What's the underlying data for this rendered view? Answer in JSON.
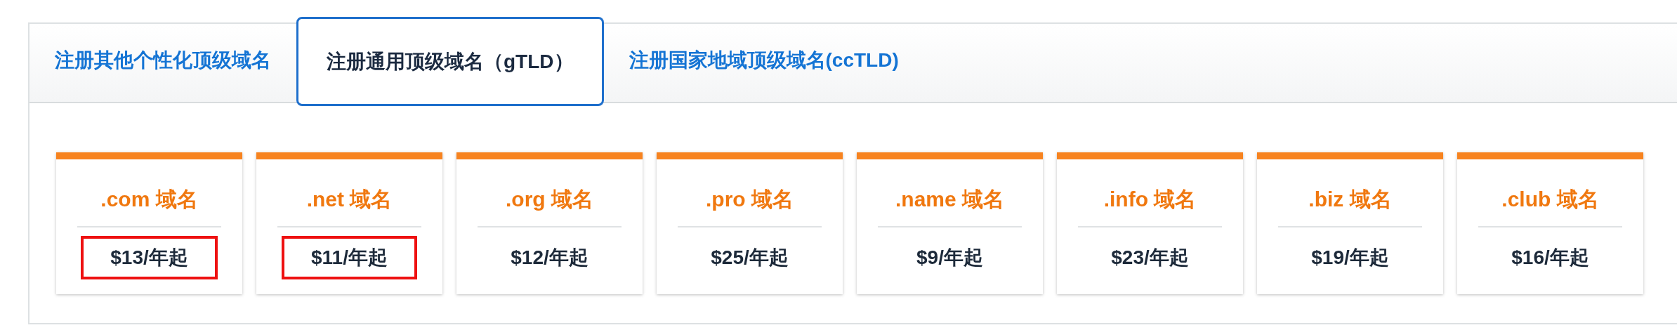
{
  "tabs": [
    {
      "label": "注册其他个性化顶级域名",
      "selected": false
    },
    {
      "label": "注册通用顶级域名（gTLD）",
      "selected": true
    },
    {
      "label": "注册国家地域顶级域名(ccTLD)",
      "selected": false
    }
  ],
  "domains": [
    {
      "name": ".com 域名",
      "price": "$13/年起",
      "highlighted": true
    },
    {
      "name": ".net 域名",
      "price": "$11/年起",
      "highlighted": true
    },
    {
      "name": ".org 域名",
      "price": "$12/年起",
      "highlighted": false
    },
    {
      "name": ".pro 域名",
      "price": "$25/年起",
      "highlighted": false
    },
    {
      "name": ".name 域名",
      "price": "$9/年起",
      "highlighted": false
    },
    {
      "name": ".info 域名",
      "price": "$23/年起",
      "highlighted": false
    },
    {
      "name": ".biz 域名",
      "price": "$19/年起",
      "highlighted": false
    },
    {
      "name": ".club 域名",
      "price": "$16/年起",
      "highlighted": false
    }
  ]
}
